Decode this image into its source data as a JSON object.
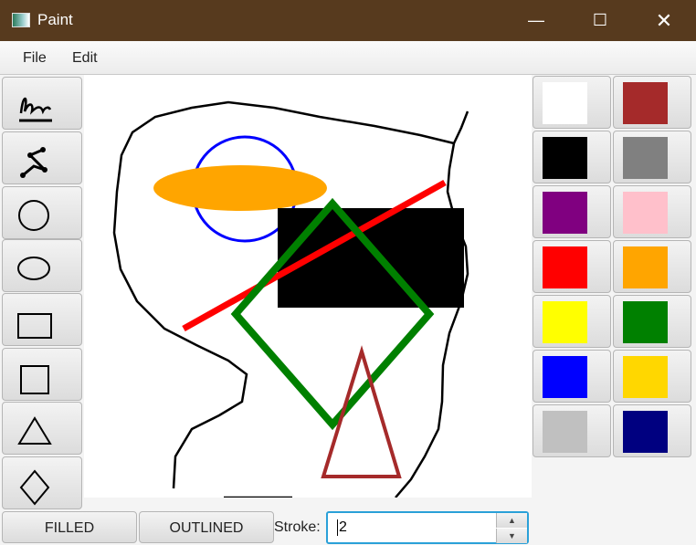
{
  "window": {
    "title": "Paint",
    "minimize_icon": "minimize-icon",
    "maximize_icon": "maximize-icon",
    "close_icon": "close-icon"
  },
  "menu": {
    "file": "File",
    "edit": "Edit"
  },
  "tools": [
    "freehand",
    "polyline",
    "circle",
    "ellipse",
    "rectangle",
    "square",
    "triangle",
    "diamond"
  ],
  "palette": [
    "#ffffff",
    "#a52a2a",
    "#000000",
    "#808080",
    "#800080",
    "#ffc0cb",
    "#ff0000",
    "#ffa500",
    "#ffff00",
    "#008000",
    "#0000ff",
    "#ffd700",
    "#c0c0c0",
    "#000080"
  ],
  "bottom": {
    "filled": "FILLED",
    "outlined": "OUTLINED",
    "stroke_label": "Stroke:",
    "stroke_value": "2"
  }
}
